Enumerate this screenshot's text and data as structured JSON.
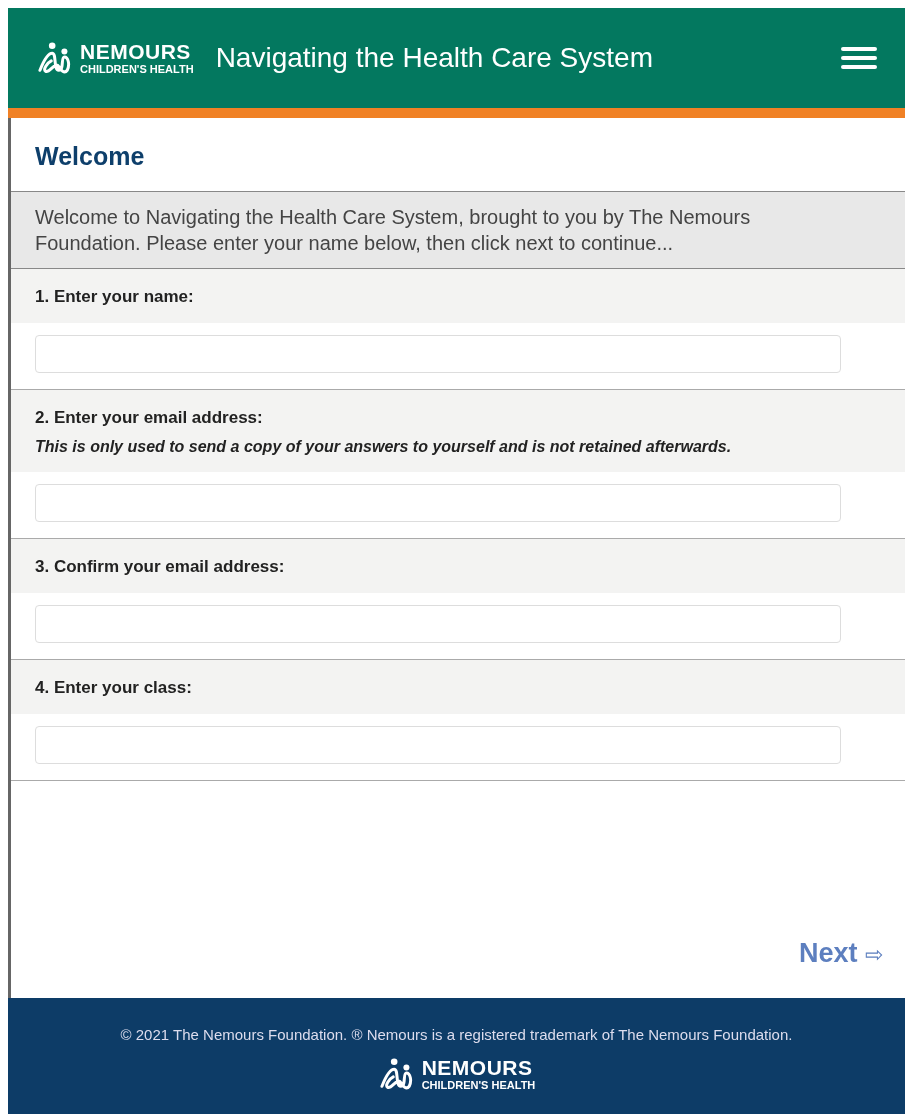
{
  "header": {
    "logo_name": "NEMOURS",
    "logo_sub": "CHILDREN'S HEALTH",
    "title": "Navigating the Health Care System"
  },
  "page_title": "Welcome",
  "intro": "Welcome to Navigating the Health Care System, brought to you by The Nemours Foundation. Please enter your name below, then click next to continue...",
  "questions": [
    {
      "label": "1. Enter your name:"
    },
    {
      "label": "2. Enter your email address:",
      "note": "This is only used to send a copy of your answers to yourself and is not retained afterwards."
    },
    {
      "label": "3. Confirm your email address:"
    },
    {
      "label": "4. Enter your class:"
    }
  ],
  "next_button": {
    "label": "Next",
    "arrow": "⇨"
  },
  "footer": {
    "copyright": "© 2021 The Nemours Foundation. ® Nemours is a registered trademark of The Nemours Foundation.",
    "logo_name": "NEMOURS",
    "logo_sub": "CHILDREN'S HEALTH"
  }
}
